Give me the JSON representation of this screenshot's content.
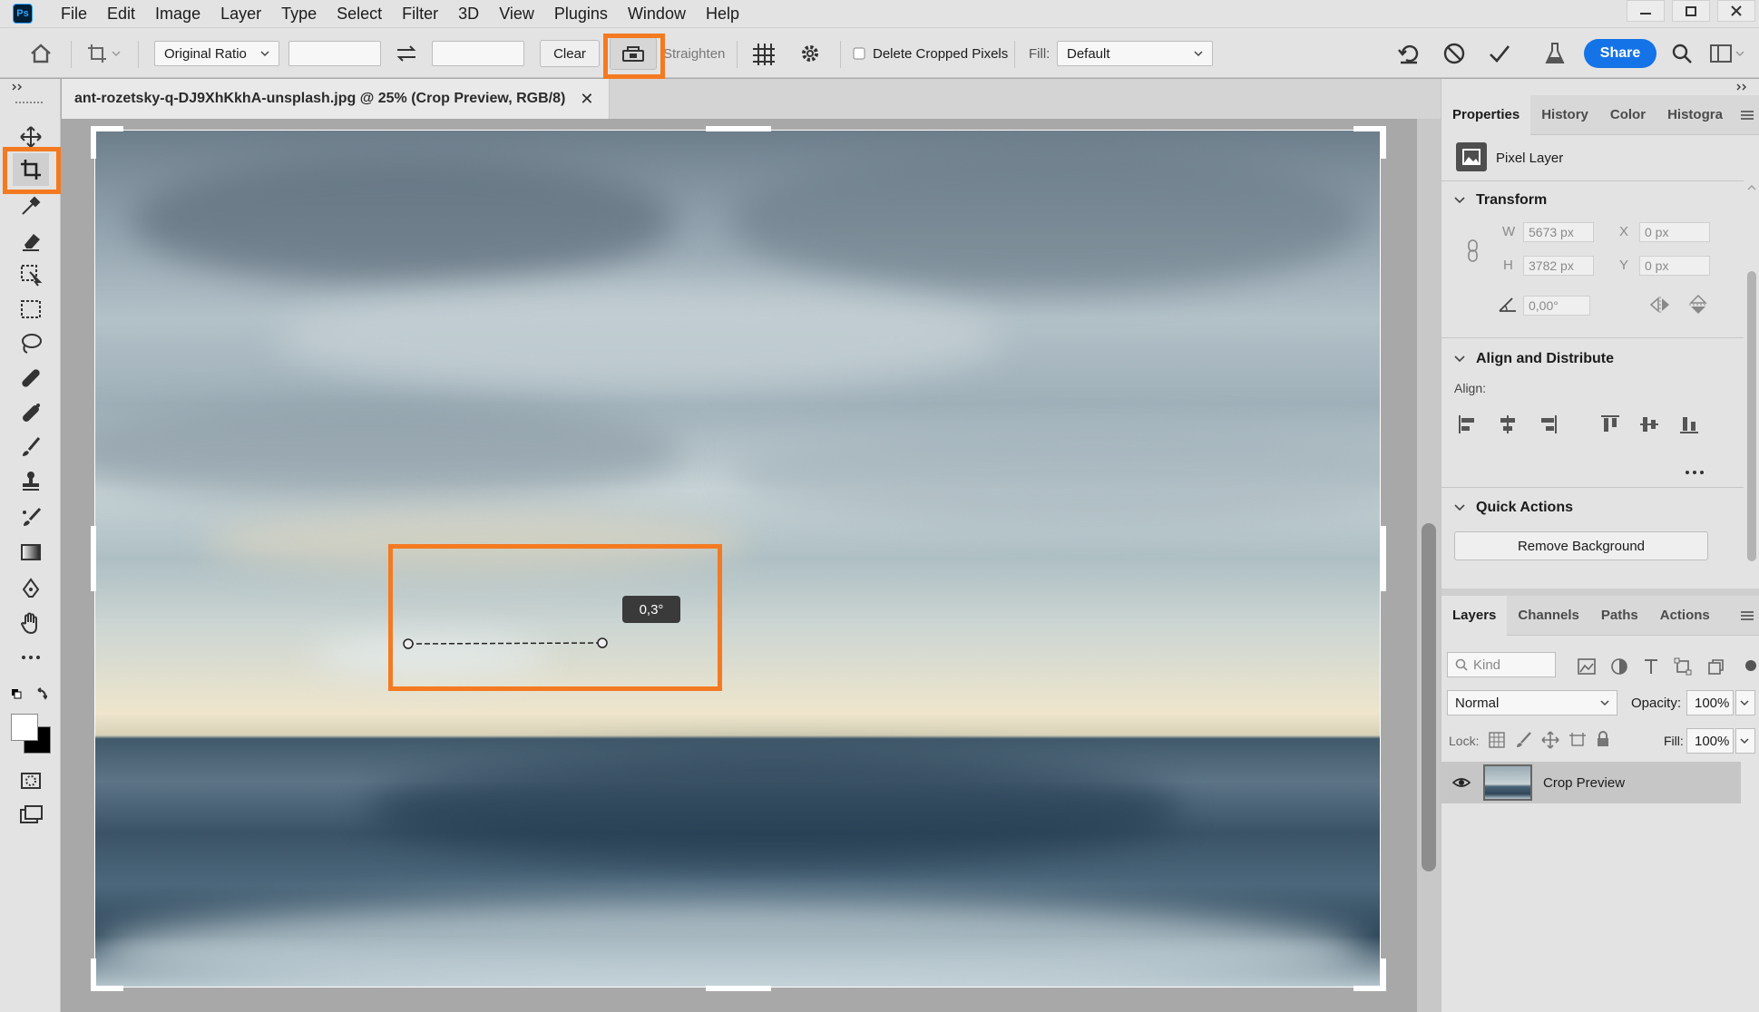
{
  "menubar": {
    "app_icon": "Ps",
    "items": [
      "File",
      "Edit",
      "Image",
      "Layer",
      "Type",
      "Select",
      "Filter",
      "3D",
      "View",
      "Plugins",
      "Window",
      "Help"
    ]
  },
  "options": {
    "ratio_select": "Original Ratio",
    "width_value": "",
    "height_value": "",
    "clear_label": "Clear",
    "straighten_label": "Straighten",
    "delete_cropped_label": "Delete Cropped Pixels",
    "fill_label": "Fill:",
    "fill_value": "Default",
    "share_label": "Share"
  },
  "document": {
    "tab_title": "ant-rozetsky-q-DJ9XhKkhA-unsplash.jpg @ 25% (Crop Preview, RGB/8)",
    "angle_readout": "0,3°"
  },
  "properties": {
    "tabs": [
      "Properties",
      "History",
      "Color",
      "Histogra"
    ],
    "layer_kind": "Pixel Layer",
    "transform_title": "Transform",
    "w_label": "W",
    "w_value": "5673 px",
    "h_label": "H",
    "h_value": "3782 px",
    "x_label": "X",
    "x_value": "0 px",
    "y_label": "Y",
    "y_value": "0 px",
    "angle_value": "0,00°",
    "align_title": "Align and Distribute",
    "align_label": "Align:",
    "quick_title": "Quick Actions",
    "remove_bg_label": "Remove Background"
  },
  "layers": {
    "tabs": [
      "Layers",
      "Channels",
      "Paths",
      "Actions"
    ],
    "kind_placeholder": "Kind",
    "blend_mode": "Normal",
    "opacity_label": "Opacity:",
    "opacity_value": "100%",
    "lock_label": "Lock:",
    "fill_label": "Fill:",
    "fill_value": "100%",
    "layer_name": "Crop Preview"
  },
  "colors": {
    "highlight": "#f47a21",
    "share": "#1473e6"
  }
}
